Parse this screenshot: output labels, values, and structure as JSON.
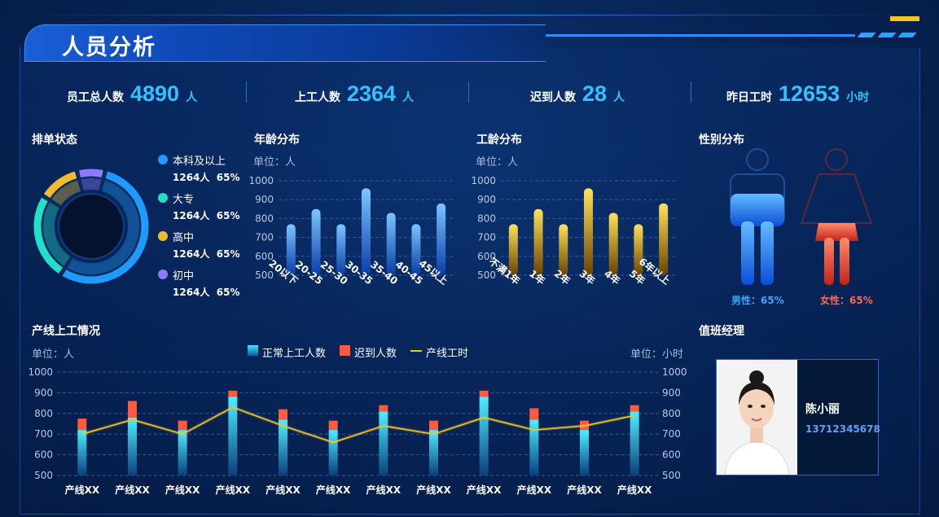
{
  "header": {
    "title": "人员分析"
  },
  "stats": [
    {
      "label": "员工总人数",
      "value": "4890",
      "unit": "人"
    },
    {
      "label": "上工人数",
      "value": "2364",
      "unit": "人"
    },
    {
      "label": "迟到人数",
      "value": "28",
      "unit": "人"
    },
    {
      "label": "昨日工时",
      "value": "12653",
      "unit": "小时"
    }
  ],
  "schedule": {
    "title": "排单状态",
    "legend": [
      {
        "label": "本科及以上",
        "value": "1264人",
        "pct": "65%",
        "color": "#1e9bff"
      },
      {
        "label": "大专",
        "value": "1264人",
        "pct": "65%",
        "color": "#22e0c8"
      },
      {
        "label": "高中",
        "value": "1264人",
        "pct": "65%",
        "color": "#f1bb31"
      },
      {
        "label": "初中",
        "value": "1264人",
        "pct": "65%",
        "color": "#8c7bff"
      }
    ]
  },
  "age": {
    "title": "年龄分布",
    "unit": "单位：人"
  },
  "tenure": {
    "title": "工龄分布",
    "unit": "单位：人"
  },
  "gender": {
    "title": "性别分布",
    "male_label": "男性：65%",
    "female_label": "女性：65%",
    "male_pct": 65,
    "female_pct": 65
  },
  "line_section": {
    "title": "产线上工情况",
    "unit_left": "单位：人",
    "unit_right": "单位：小时",
    "legend": [
      "正常上工人数",
      "迟到人数",
      "产线工时"
    ]
  },
  "manager": {
    "title": "值班经理",
    "name": "陈小丽",
    "phone": "13712345678"
  },
  "chart_data": [
    {
      "type": "bar",
      "title": "年龄分布",
      "ylabel": "单位：人",
      "categories": [
        "20以下",
        "20-25",
        "25-30",
        "30-35",
        "35-40",
        "40-45",
        "45以上"
      ],
      "values": [
        770,
        850,
        770,
        960,
        830,
        770,
        880
      ],
      "ylim": [
        500,
        1000
      ],
      "yticks": [
        500,
        600,
        700,
        800,
        900,
        1000
      ]
    },
    {
      "type": "bar",
      "title": "工龄分布",
      "ylabel": "单位：人",
      "categories": [
        "不满1年",
        "1年",
        "2年",
        "3年",
        "4年",
        "5年",
        "6年以上"
      ],
      "values": [
        770,
        850,
        770,
        960,
        830,
        770,
        880
      ],
      "ylim": [
        500,
        1000
      ],
      "yticks": [
        500,
        600,
        700,
        800,
        900,
        1000
      ]
    },
    {
      "type": "bar",
      "title": "产线上工情况",
      "categories": [
        "产线XX",
        "产线XX",
        "产线XX",
        "产线XX",
        "产线XX",
        "产线XX",
        "产线XX",
        "产线XX",
        "产线XX",
        "产线XX",
        "产线XX",
        "产线XX"
      ],
      "series": [
        {
          "name": "正常上工人数",
          "values": [
            720,
            780,
            720,
            880,
            770,
            720,
            810,
            720,
            880,
            770,
            720,
            810
          ]
        },
        {
          "name": "迟到人数",
          "values": [
            55,
            80,
            45,
            30,
            50,
            45,
            30,
            45,
            30,
            55,
            45,
            30
          ]
        },
        {
          "name": "产线工时",
          "values": [
            700,
            770,
            700,
            830,
            740,
            660,
            740,
            700,
            780,
            720,
            740,
            790
          ]
        }
      ],
      "ylim": [
        500,
        1000
      ],
      "yticks": [
        500,
        600,
        700,
        800,
        900,
        1000
      ]
    },
    {
      "type": "pie",
      "title": "排单状态",
      "labels": [
        "本科及以上",
        "大专",
        "高中",
        "初中"
      ],
      "values": [
        55,
        25,
        12,
        8
      ]
    }
  ]
}
